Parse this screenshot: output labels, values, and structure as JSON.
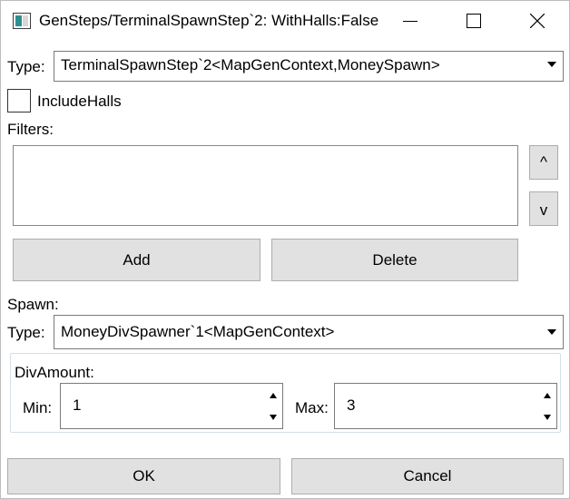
{
  "window": {
    "title": "GenSteps/TerminalSpawnStep`2: WithHalls:False"
  },
  "type_field": {
    "label": "Type:",
    "value": "TerminalSpawnStep`2<MapGenContext,MoneySpawn>"
  },
  "include_halls": {
    "label": "IncludeHalls",
    "checked": false
  },
  "filters": {
    "label": "Filters:",
    "items": [],
    "move_up_label": "^",
    "move_down_label": "v",
    "add_label": "Add",
    "delete_label": "Delete"
  },
  "spawn": {
    "label": "Spawn:",
    "type_label": "Type:",
    "type_value": "MoneyDivSpawner`1<MapGenContext>",
    "div_amount": {
      "label": "DivAmount:",
      "min_label": "Min:",
      "min_value": "1",
      "max_label": "Max:",
      "max_value": "3"
    }
  },
  "footer": {
    "ok_label": "OK",
    "cancel_label": "Cancel"
  },
  "icons": {
    "app": "window-app-icon",
    "minimize": "minimize-icon",
    "maximize": "maximize-icon",
    "close": "close-icon",
    "dropdown": "chevron-down-icon"
  }
}
